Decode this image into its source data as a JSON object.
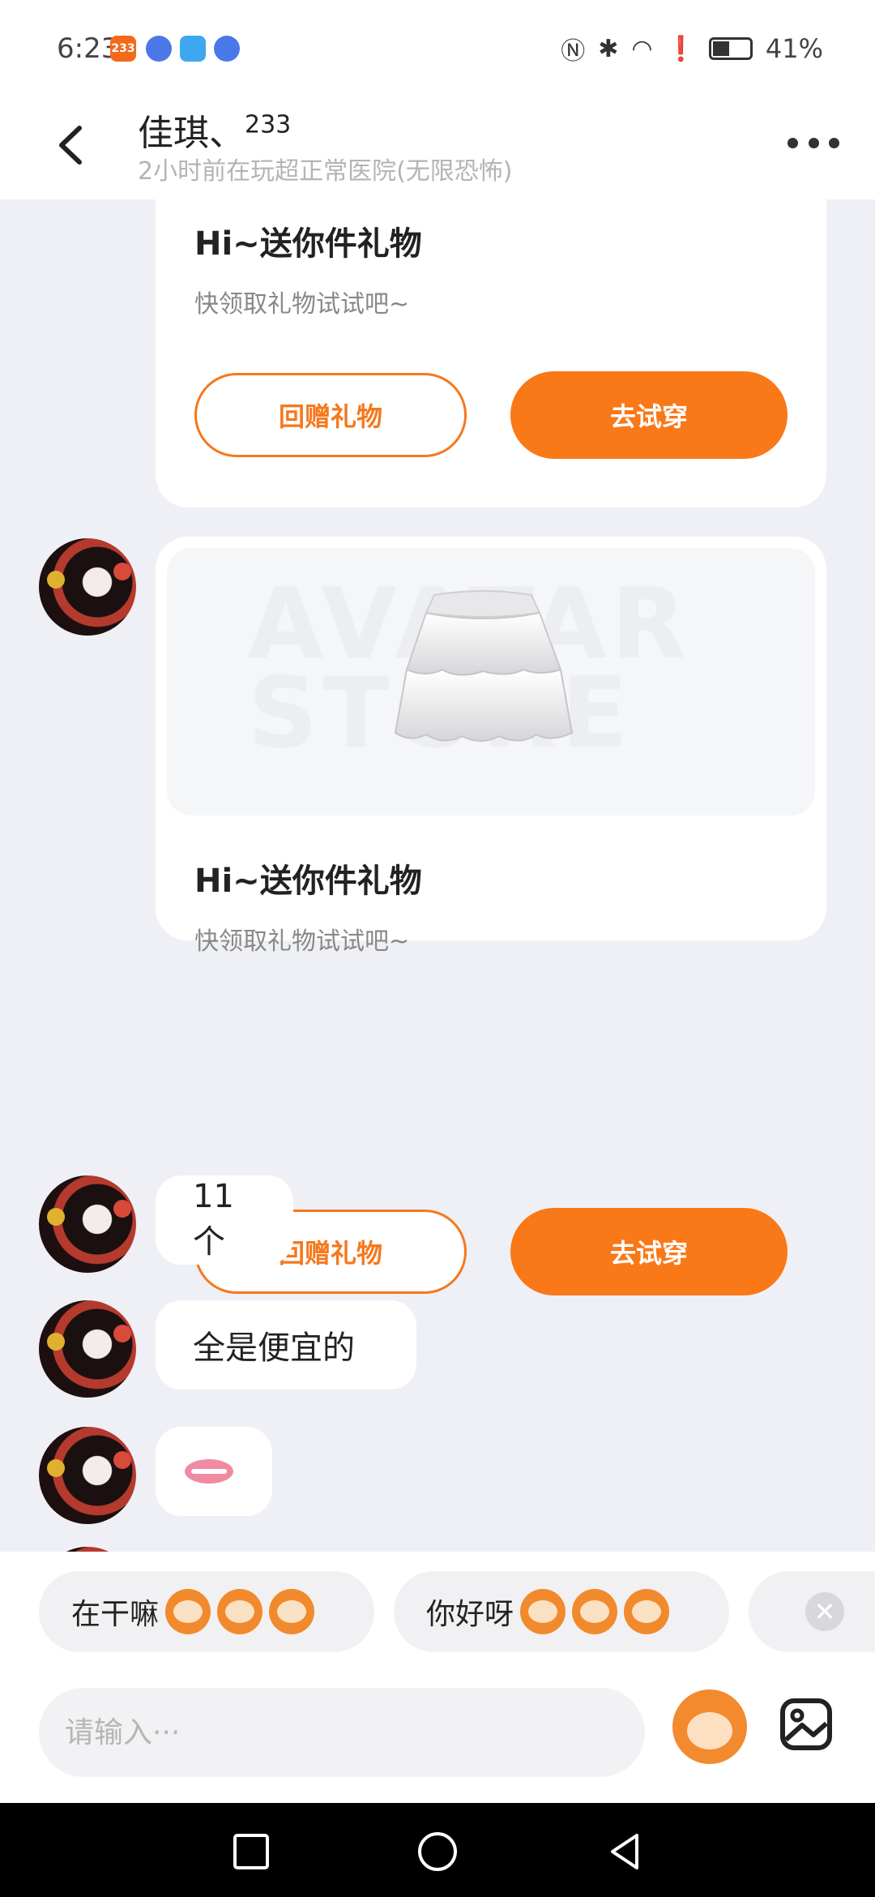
{
  "status_bar": {
    "time": "6:23",
    "badge": "233",
    "battery": "41%"
  },
  "header": {
    "contact_name": "佳琪、",
    "contact_name_sup": "233",
    "contact_status": "2小时前在玩超正常医院(无限恐怖)"
  },
  "messages": [
    {
      "type": "gift",
      "title": "Hi~送你件礼物",
      "subtitle": "快领取礼物试试吧~",
      "return_gift_label": "回赠礼物",
      "try_on_label": "去试穿"
    },
    {
      "type": "gift",
      "image_watermark": "AVATAR STORE",
      "title": "Hi~送你件礼物",
      "subtitle": "快领取礼物试试吧~",
      "return_gift_label": "回赠礼物",
      "try_on_label": "去试穿"
    },
    {
      "type": "text",
      "text": "11个"
    },
    {
      "type": "text",
      "text": "全是便宜的"
    },
    {
      "type": "emoji",
      "text": "👄"
    }
  ],
  "quick_replies": [
    {
      "text": "在干嘛"
    },
    {
      "text": "你好呀"
    }
  ],
  "input": {
    "placeholder": "请输入···"
  },
  "colors": {
    "accent": "#f97818",
    "background": "#eef0f5"
  }
}
